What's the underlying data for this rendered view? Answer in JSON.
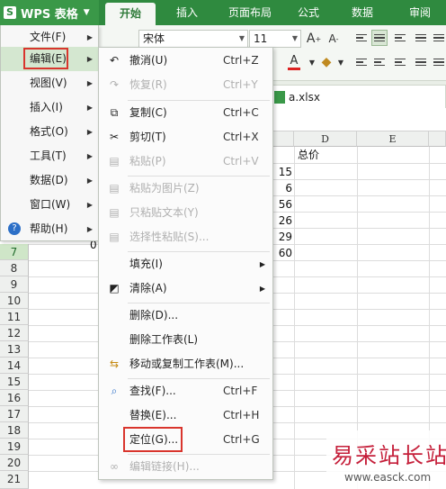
{
  "app": {
    "menu_label": "WPS 表格",
    "logo_letter": "S"
  },
  "tabs": [
    {
      "label": "开始"
    },
    {
      "label": "插入"
    },
    {
      "label": "页面布局"
    },
    {
      "label": "公式"
    },
    {
      "label": "数据"
    },
    {
      "label": "审阅"
    }
  ],
  "ribbon": {
    "font_name": "宋体",
    "font_size": "11",
    "grow_font": "A",
    "shrink_font": "A",
    "font_color_letter": "A"
  },
  "file": {
    "name": "a.xlsx"
  },
  "columns": [
    "D",
    "E"
  ],
  "rows": [
    "7",
    "8",
    "9",
    "10",
    "11",
    "12",
    "13",
    "14",
    "15",
    "16",
    "17",
    "18",
    "19",
    "20",
    "21"
  ],
  "cells": {
    "d_header": "总价",
    "c_values": [
      "15",
      "6",
      "56",
      "26",
      "29",
      "60"
    ],
    "row7_partial": "0"
  },
  "left_menu": [
    {
      "label": "文件(F)",
      "arrow": "▶"
    },
    {
      "label": "编辑(E)",
      "arrow": "▶"
    },
    {
      "label": "视图(V)",
      "arrow": "▶"
    },
    {
      "label": "插入(I)",
      "arrow": "▶"
    },
    {
      "label": "格式(O)",
      "arrow": "▶"
    },
    {
      "label": "工具(T)",
      "arrow": "▶"
    },
    {
      "label": "数据(D)",
      "arrow": "▶"
    },
    {
      "label": "窗口(W)",
      "arrow": "▶"
    },
    {
      "label": "帮助(H)",
      "arrow": "▶"
    }
  ],
  "edit_menu": [
    {
      "label": "撤消(U)",
      "shortcut": "Ctrl+Z",
      "icon": "undo-icon",
      "enabled": true
    },
    {
      "label": "恢复(R)",
      "shortcut": "Ctrl+Y",
      "icon": "redo-icon",
      "enabled": false
    },
    {
      "label": "复制(C)",
      "shortcut": "Ctrl+C",
      "icon": "copy-icon",
      "enabled": true
    },
    {
      "label": "剪切(T)",
      "shortcut": "Ctrl+X",
      "icon": "cut-icon",
      "enabled": true
    },
    {
      "label": "粘贴(P)",
      "shortcut": "Ctrl+V",
      "icon": "paste-icon",
      "enabled": false
    },
    {
      "label": "粘贴为图片(Z)",
      "shortcut": "",
      "icon": "paste-image-icon",
      "enabled": false
    },
    {
      "label": "只粘贴文本(Y)",
      "shortcut": "",
      "icon": "paste-text-icon",
      "enabled": false
    },
    {
      "label": "选择性粘贴(S)...",
      "shortcut": "",
      "icon": "paste-special-icon",
      "enabled": false
    },
    {
      "label": "填充(I)",
      "shortcut": "",
      "arrow": "▶",
      "enabled": true
    },
    {
      "label": "清除(A)",
      "shortcut": "",
      "arrow": "▶",
      "icon": "eraser-icon",
      "enabled": true
    },
    {
      "label": "删除(D)...",
      "shortcut": "",
      "enabled": true
    },
    {
      "label": "删除工作表(L)",
      "shortcut": "",
      "enabled": true
    },
    {
      "label": "移动或复制工作表(M)...",
      "shortcut": "",
      "icon": "move-sheet-icon",
      "enabled": true
    },
    {
      "label": "查找(F)...",
      "shortcut": "Ctrl+F",
      "icon": "find-icon",
      "enabled": true
    },
    {
      "label": "替换(E)...",
      "shortcut": "Ctrl+H",
      "enabled": true
    },
    {
      "label": "定位(G)...",
      "shortcut": "Ctrl+G",
      "enabled": true
    },
    {
      "label": "编辑链接(H)...",
      "shortcut": "",
      "icon": "link-icon",
      "enabled": false
    }
  ],
  "watermark": {
    "title": "易采站长站",
    "url": "www.easck.com"
  },
  "colors": {
    "brand": "#2f8a3f",
    "highlight_box": "#d9352d",
    "watermark": "#c51f3a"
  }
}
